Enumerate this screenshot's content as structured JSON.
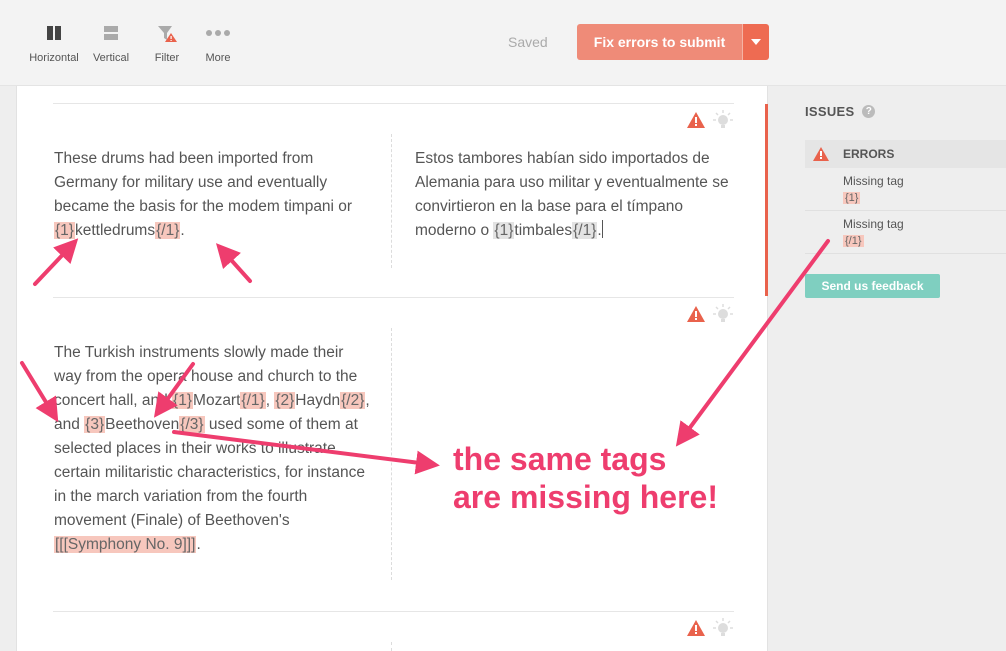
{
  "toolbar": {
    "tools": [
      {
        "label": "Horizontal",
        "icon": "columns-icon"
      },
      {
        "label": "Vertical",
        "icon": "rows-icon"
      },
      {
        "label": "Filter",
        "icon": "filter-warning-icon"
      },
      {
        "label": "More",
        "icon": "more-dots-icon"
      }
    ],
    "saved_label": "Saved",
    "fix_button_label": "Fix errors to submit"
  },
  "segments": [
    {
      "source": [
        {
          "t": "These drums had been imported from Germany for military use and eventually became the basis for the modem timpani or "
        },
        {
          "tag": "{1}"
        },
        {
          "t": "kettledrums"
        },
        {
          "tag": "{/1}"
        },
        {
          "t": "."
        }
      ],
      "target": [
        {
          "t": "Estos tambores habían sido importados de Alemania para uso militar y eventualmente se convirtieron en la base para el tímpano moderno o "
        },
        {
          "tagg": "{1}"
        },
        {
          "t": "timbales"
        },
        {
          "tagg": "{/1}"
        },
        {
          "t": "."
        }
      ]
    },
    {
      "source": [
        {
          "t": " The Turkish instruments slowly made their way from the opera house and church to the concert hall, and "
        },
        {
          "tag": "{1}"
        },
        {
          "t": "Mozart"
        },
        {
          "tag": "{/1}"
        },
        {
          "t": ", "
        },
        {
          "tag": "{2}"
        },
        {
          "t": "Haydn"
        },
        {
          "tag": "{/2}"
        },
        {
          "t": ", and "
        },
        {
          "tag": "{3}"
        },
        {
          "t": "Beethoven"
        },
        {
          "tag": "{/3}"
        },
        {
          "t": " used some of them at selected places in their works to illustrate certain militaristic characteristics, for instance in the march variation from the fourth movement (Finale) of Beethoven's "
        },
        {
          "tag": "[[[Symphony No. 9]]]"
        },
        {
          "t": "."
        }
      ],
      "target": []
    }
  ],
  "issues": {
    "title": "ISSUES",
    "help": "?",
    "errors_header": "ERRORS",
    "items": [
      {
        "name": "Missing tag",
        "tag": "{1}"
      },
      {
        "name": "Missing tag",
        "tag": "{/1}"
      }
    ],
    "feedback_label": "Send us feedback"
  },
  "annotation": {
    "callout_line1": "the same tags",
    "callout_line2": "are missing here!"
  },
  "colors": {
    "accent_button": "#ef8b78",
    "warning": "#e9624c",
    "tag_bg": "#f7c7bd",
    "arrow": "#ee3d6e",
    "feedback_button": "#7fcfc0"
  }
}
